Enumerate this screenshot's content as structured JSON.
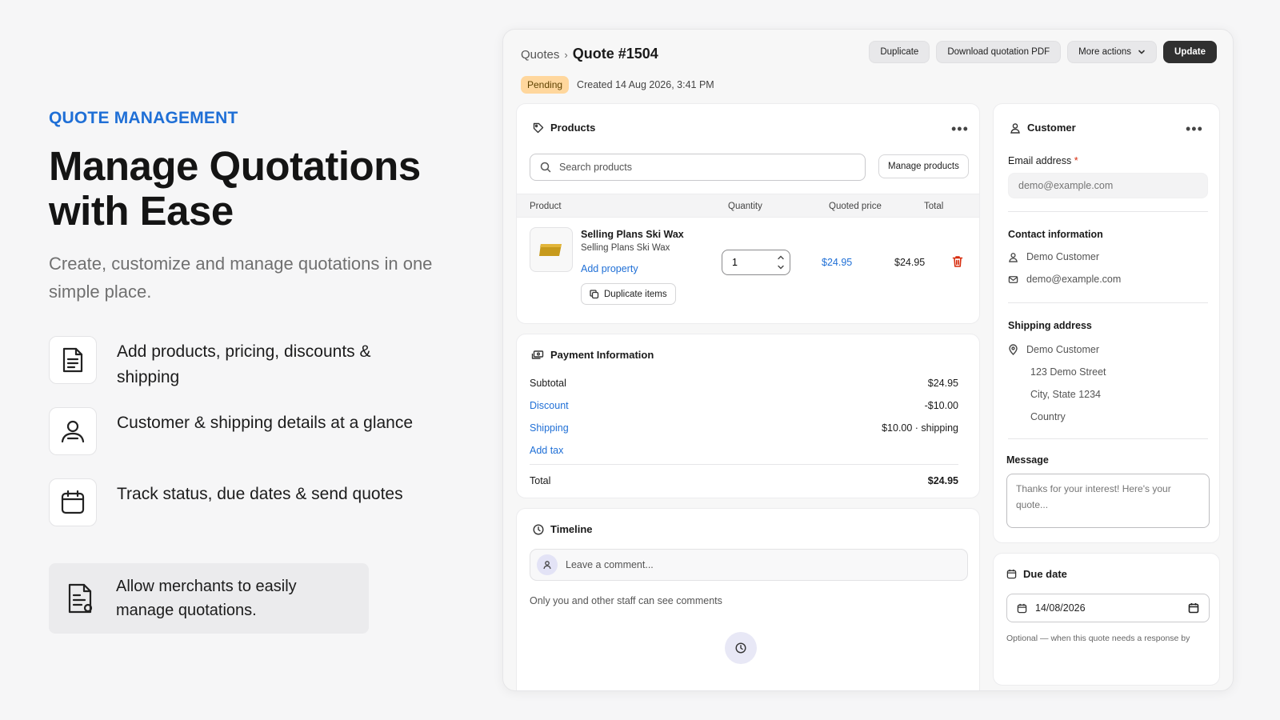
{
  "hero": {
    "eyebrow": "QUOTE MANAGEMENT",
    "headline": "Manage Quotations with Ease",
    "subhead": "Create, customize and manage quotations in one simple place.",
    "features": [
      {
        "icon": "document-icon",
        "text": "Add products, pricing, discounts & shipping"
      },
      {
        "icon": "user-icon",
        "text": "Customer & shipping details at a glance"
      },
      {
        "icon": "calendar-icon",
        "text": "Track status, due dates & send quotes"
      }
    ],
    "callout": {
      "icon": "quote-document-icon",
      "text": "Allow merchants to easily manage quotations."
    }
  },
  "header": {
    "breadcrumb_parent": "Quotes",
    "breadcrumb_separator": "›",
    "title": "Quote #1504",
    "status": "Pending",
    "created": "Created 14 Aug 2026, 3:41 PM",
    "actions": {
      "duplicate": "Duplicate",
      "download": "Download quotation PDF",
      "more": "More actions",
      "update": "Update"
    }
  },
  "products": {
    "title": "Products",
    "menu": "•••",
    "search_placeholder": "Search products",
    "manage_button": "Manage products",
    "columns": [
      "Product",
      "Quantity",
      "Quoted price",
      "Total"
    ],
    "items": [
      {
        "name": "Selling Plans Ski Wax",
        "variant": "Selling Plans Ski Wax",
        "add_property": "Add property",
        "duplicate_label": "Duplicate items",
        "quantity": "1",
        "quoted_price": "$24.95",
        "total": "$24.95"
      }
    ]
  },
  "payment": {
    "title": "Payment Information",
    "subtotal_label": "Subtotal",
    "subtotal_value": "$24.95",
    "discount_label": "Discount",
    "discount_value": "-$10.00",
    "shipping_label": "Shipping",
    "shipping_value": "$10.00 · shipping",
    "add_tax_label": "Add tax",
    "total_label": "Total",
    "total_value": "$24.95"
  },
  "timeline": {
    "title": "Timeline",
    "comment_placeholder": "Leave a comment...",
    "note": "Only you and other staff can see comments"
  },
  "customer": {
    "title": "Customer",
    "menu": "•••",
    "email_label": "Email address",
    "required_mark": "*",
    "email_placeholder": "demo@example.com",
    "contact_title": "Contact information",
    "contact_name": "Demo Customer",
    "contact_email": "demo@example.com",
    "shipping_title": "Shipping address",
    "shipping_name": "Demo Customer",
    "shipping_street": "123 Demo Street",
    "shipping_city": "City, State 1234",
    "shipping_country": "Country",
    "message_label": "Message",
    "message_placeholder": "Thanks for your interest! Here's your quote..."
  },
  "due_date": {
    "title": "Due date",
    "value": "14/08/2026",
    "hint": "Optional — when this quote needs a response by"
  },
  "colors": {
    "accent_blue": "#1f6fd6",
    "badge_pending": "#ffd79d",
    "primary_button": "#303030",
    "danger": "#d72c0d"
  }
}
